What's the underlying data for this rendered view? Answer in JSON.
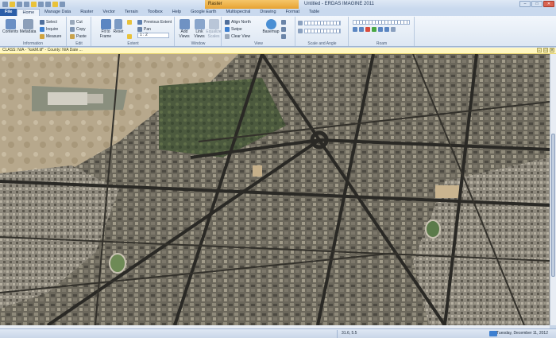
{
  "app": {
    "window_title": "Untitled - ERDAS IMAGINE 2011",
    "context_tab": "Raster"
  },
  "tabs": [
    "File",
    "Home",
    "Manage Data",
    "Raster",
    "Vector",
    "Terrain",
    "Toolbox",
    "Help",
    "Google Earth",
    "Multispectral",
    "Drawing",
    "Format",
    "Table"
  ],
  "ribbon": {
    "information": {
      "label": "Information",
      "contents": "Contents",
      "metadata": "Metadata",
      "select": "Select",
      "inquire": "Inquire",
      "measure": "Measure"
    },
    "edit": {
      "label": "Edit",
      "cut": "Cut",
      "copy": "Copy",
      "paste": "Paste"
    },
    "extent": {
      "label": "Extent",
      "fit_to_frame": "Fit to Frame",
      "reset": "Reset",
      "previous_extent": "Previous Extent",
      "pan": "Pan",
      "scale_value": "1 : 2"
    },
    "window": {
      "label": "Window",
      "add_views": "Add Views",
      "link_views": "Link Views",
      "equalize_scales": "Equalize Scales"
    },
    "view": {
      "label": "View",
      "align_north": "Align North",
      "swipe": "Swipe",
      "clear_view": "Clear View",
      "basemap": "Basemap"
    },
    "scale_angle": {
      "label": "Scale and Angle"
    },
    "roam": {
      "label": "Roam"
    }
  },
  "viewer": {
    "header": "CLASS: N/A - \"kskM.tif\" - County: N/A Date ..."
  },
  "status": {
    "coord": "31.6, 5.5",
    "date": "Tuesday, December 11, 2012"
  },
  "colors": {
    "file_tab": "#2b5ea8",
    "context_tab": "#e6a233",
    "ribbon": "#eef3fa",
    "viewer_header": "#fff7c2"
  }
}
